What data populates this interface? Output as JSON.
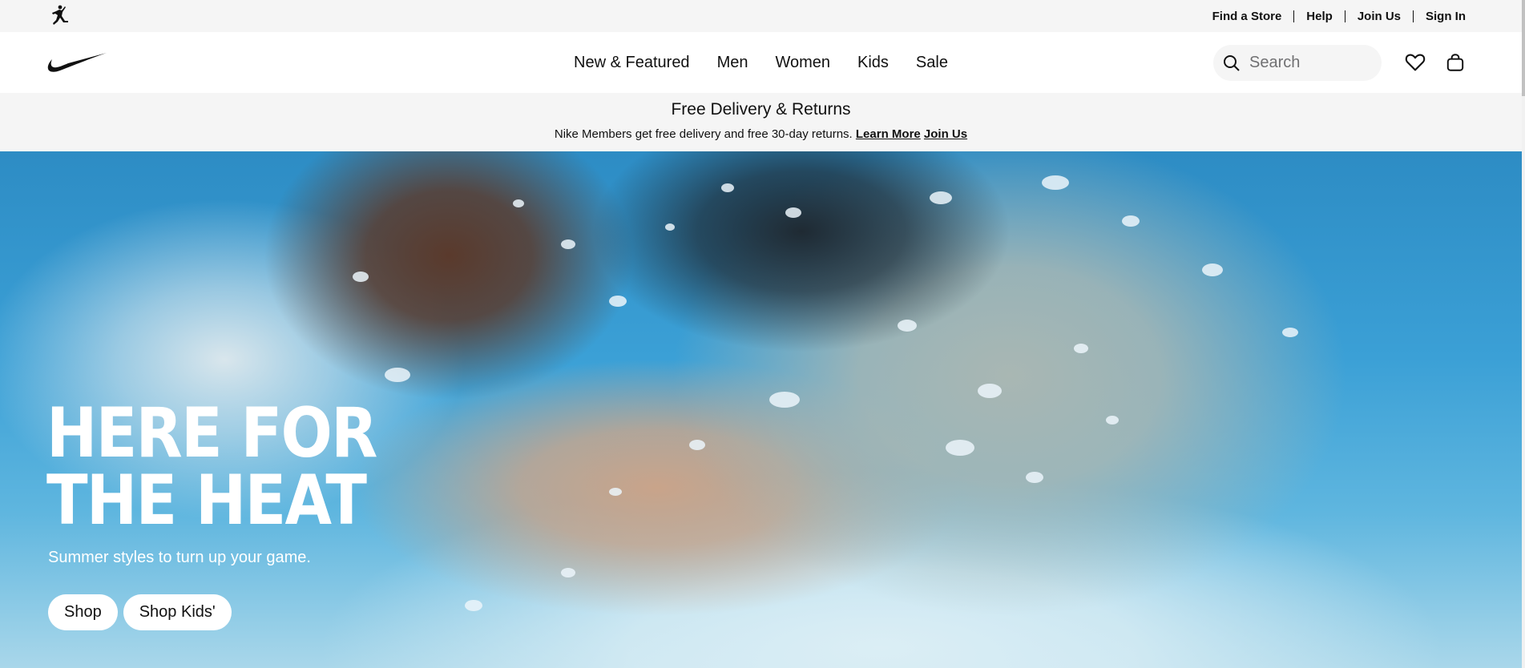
{
  "utility_bar": {
    "links": [
      "Find a Store",
      "Help",
      "Join Us",
      "Sign In"
    ],
    "logo_icon": "jordan-jumpman-icon"
  },
  "header": {
    "logo_icon": "nike-swoosh-icon",
    "nav": [
      "New & Featured",
      "Men",
      "Women",
      "Kids",
      "Sale"
    ],
    "search_placeholder": "Search",
    "favorites_icon": "heart-icon",
    "bag_icon": "bag-icon"
  },
  "promo": {
    "title": "Free Delivery & Returns",
    "text": "Nike Members get free delivery and free 30-day returns.",
    "learn_more": "Learn More",
    "join_us": "Join Us"
  },
  "hero": {
    "headline_line1": "HERE FOR",
    "headline_line2": "THE HEAT",
    "subtitle": "Summer styles to turn up your game.",
    "buttons": [
      "Shop",
      "Shop Kids'"
    ]
  },
  "colors": {
    "text": "#111111",
    "bar_bg": "#f5f5f5",
    "hero_water": "#3ba0d6"
  }
}
